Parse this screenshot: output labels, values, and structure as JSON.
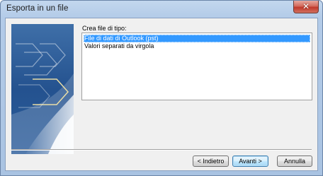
{
  "window": {
    "title": "Esporta in un file",
    "close_icon": "close-icon"
  },
  "form": {
    "list_label": "Crea file di tipo:",
    "file_types": [
      {
        "label": "File di dati di Outlook (pst)",
        "selected": true
      },
      {
        "label": "Valori separati da virgola",
        "selected": false
      }
    ]
  },
  "buttons": {
    "back_label": "< Indietro",
    "next_label": "Avanti >",
    "cancel_label": "Annulla"
  },
  "colors": {
    "selection": "#3399ff",
    "frame": "#b3cbe8",
    "close_button": "#c0392b"
  }
}
